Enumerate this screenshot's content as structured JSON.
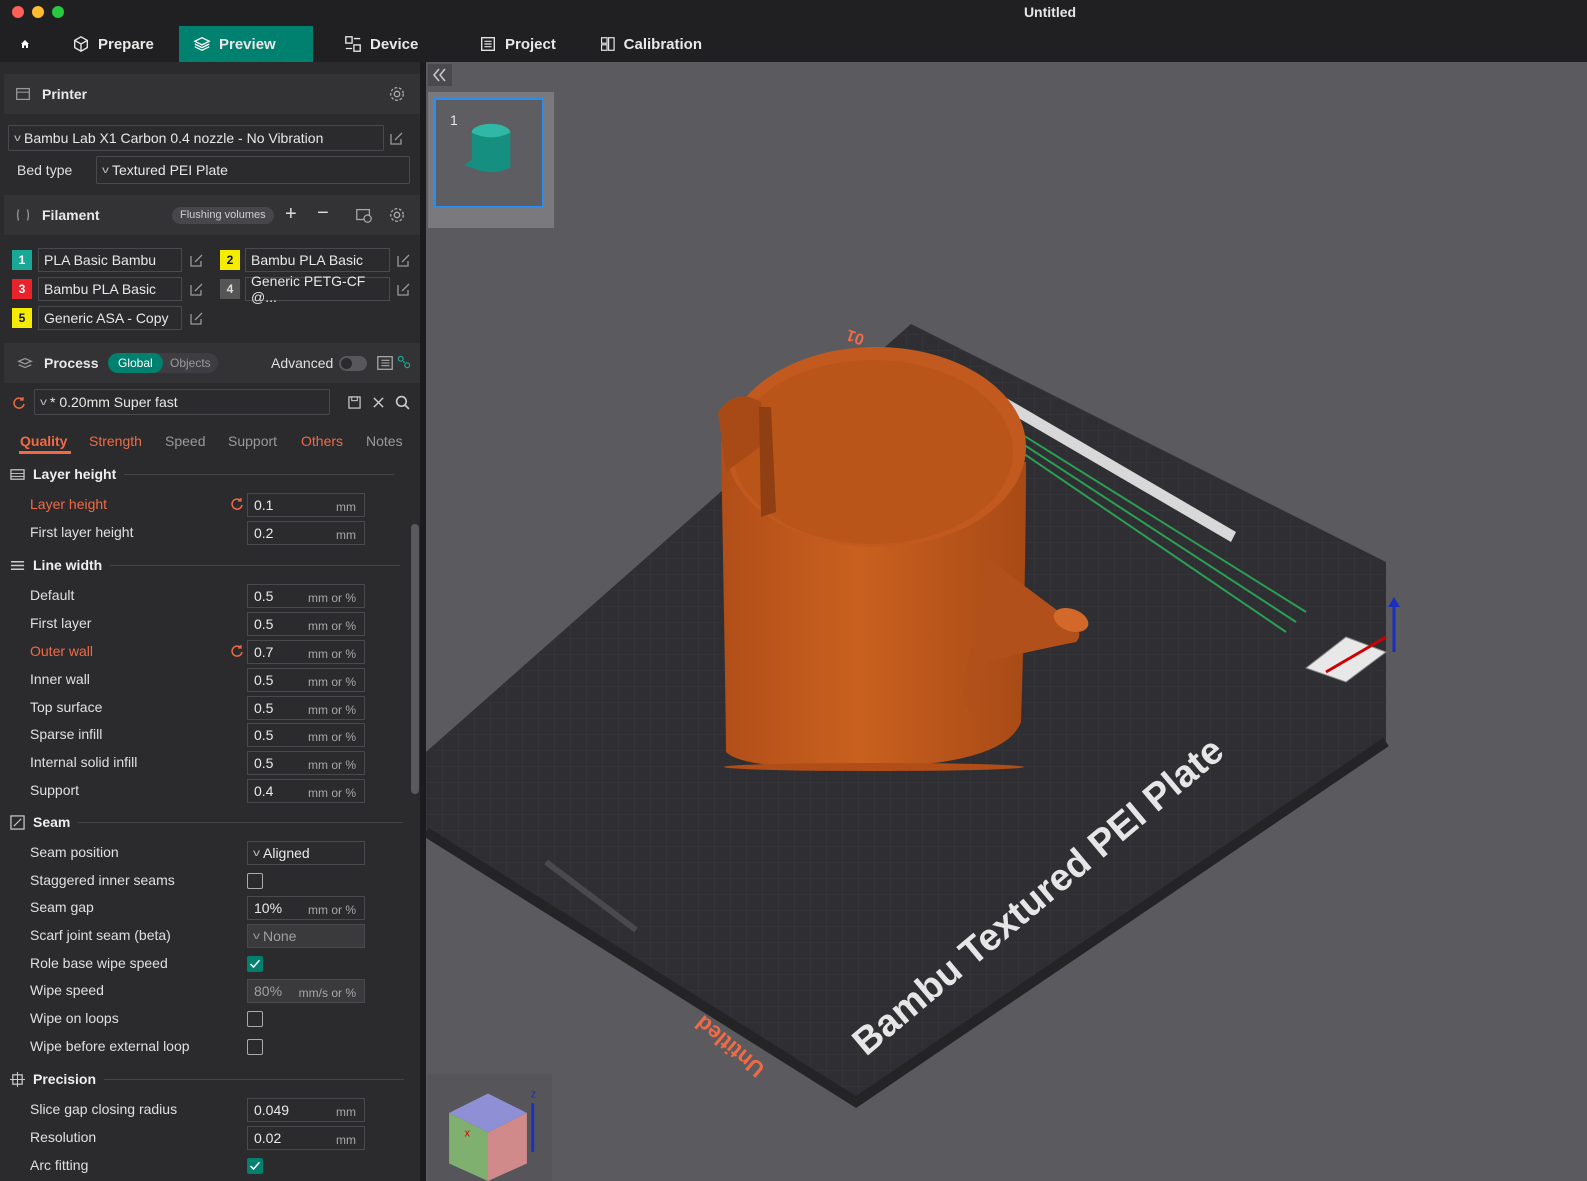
{
  "window": {
    "title": "Untitled"
  },
  "nav": {
    "home": "home",
    "prepare": "Prepare",
    "preview": "Preview",
    "device": "Device",
    "project": "Project",
    "calibration": "Calibration"
  },
  "printer": {
    "section_label": "Printer",
    "profile": "Bambu Lab X1 Carbon 0.4 nozzle - No Vibration",
    "bed_type_label": "Bed type",
    "bed_type": "Textured PEI Plate"
  },
  "filament": {
    "section_label": "Filament",
    "flushing_label": "Flushing volumes",
    "slots": [
      {
        "num": "1",
        "name": "PLA Basic Bambu",
        "color": "#1aa896",
        "numcolor": "#ffffff"
      },
      {
        "num": "2",
        "name": "Bambu PLA Basic",
        "color": "#f5ec00",
        "numcolor": "#111111"
      },
      {
        "num": "3",
        "name": "Bambu PLA Basic",
        "color": "#e8232c",
        "numcolor": "#ffffff"
      },
      {
        "num": "4",
        "name": "Generic PETG-CF @...",
        "color": "#555555",
        "numcolor": "#dddddd"
      },
      {
        "num": "5",
        "name": "Generic ASA - Copy",
        "color": "#f5ec00",
        "numcolor": "#111111"
      }
    ]
  },
  "process": {
    "section_label": "Process",
    "toggle_global": "Global",
    "toggle_objects": "Objects",
    "advanced_label": "Advanced",
    "preset": "* 0.20mm Super fast",
    "tabs": [
      "Quality",
      "Strength",
      "Speed",
      "Support",
      "Others",
      "Notes"
    ]
  },
  "groups": {
    "layer_height": "Layer height",
    "line_width": "Line width",
    "seam": "Seam",
    "precision": "Precision"
  },
  "settings": {
    "layer_height": {
      "label": "Layer height",
      "value": "0.1",
      "unit": "mm"
    },
    "first_layer_height": {
      "label": "First layer height",
      "value": "0.2",
      "unit": "mm"
    },
    "lw_default": {
      "label": "Default",
      "value": "0.5",
      "unit": "mm or %"
    },
    "lw_first_layer": {
      "label": "First layer",
      "value": "0.5",
      "unit": "mm or %"
    },
    "lw_outer_wall": {
      "label": "Outer wall",
      "value": "0.7",
      "unit": "mm or %"
    },
    "lw_inner_wall": {
      "label": "Inner wall",
      "value": "0.5",
      "unit": "mm or %"
    },
    "lw_top_surface": {
      "label": "Top surface",
      "value": "0.5",
      "unit": "mm or %"
    },
    "lw_sparse_infill": {
      "label": "Sparse infill",
      "value": "0.5",
      "unit": "mm or %"
    },
    "lw_internal_solid": {
      "label": "Internal solid infill",
      "value": "0.5",
      "unit": "mm or %"
    },
    "lw_support": {
      "label": "Support",
      "value": "0.4",
      "unit": "mm or %"
    },
    "seam_position": {
      "label": "Seam position",
      "value": "Aligned"
    },
    "staggered": {
      "label": "Staggered inner seams"
    },
    "seam_gap": {
      "label": "Seam gap",
      "value": "10%",
      "unit": "mm or %"
    },
    "scarf": {
      "label": "Scarf joint seam (beta)",
      "value": "None"
    },
    "role_wipe": {
      "label": "Role base wipe speed"
    },
    "wipe_speed": {
      "label": "Wipe speed",
      "value": "80%",
      "unit": "mm/s or %"
    },
    "wipe_loops": {
      "label": "Wipe on loops"
    },
    "wipe_before": {
      "label": "Wipe before external loop"
    },
    "slice_gap": {
      "label": "Slice gap closing radius",
      "value": "0.049",
      "unit": "mm"
    },
    "resolution": {
      "label": "Resolution",
      "value": "0.02",
      "unit": "mm"
    },
    "arc_fitting": {
      "label": "Arc fitting"
    }
  },
  "viewport": {
    "plate_thumb_number": "1",
    "bed_label": "Bambu Textured PEI Plate",
    "plate_name": "Untitled",
    "plate_index": "01",
    "axis_x": "x",
    "axis_z": "z"
  },
  "colors": {
    "accent": "#00806e",
    "modified": "#f06b45",
    "model": "#c4581c"
  }
}
